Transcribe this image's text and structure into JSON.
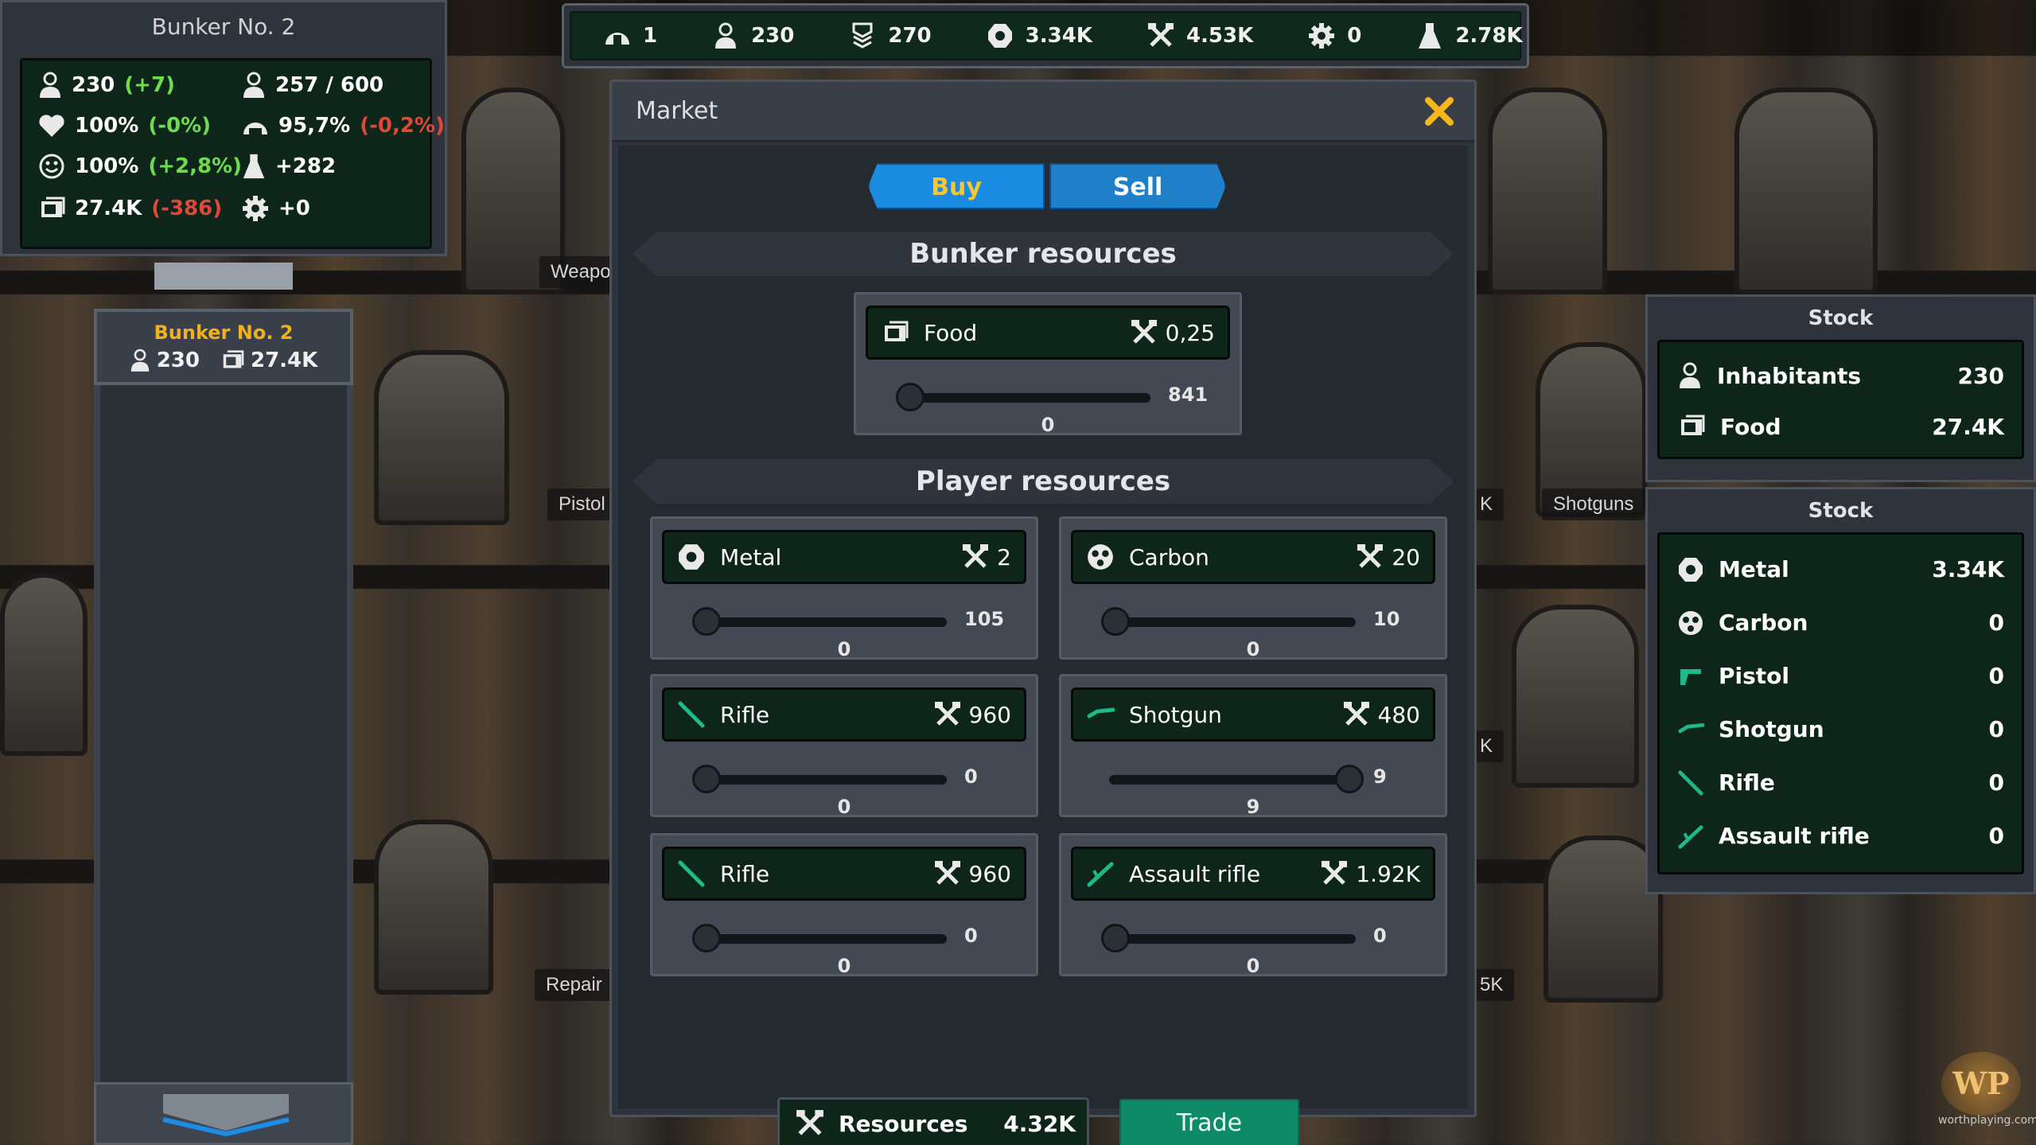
{
  "room_labels": [
    "Weapo",
    "Pistol",
    "Repair",
    "Shotguns",
    "K",
    "K",
    "5K"
  ],
  "topbar": {
    "items": [
      {
        "icon": "dome-icon",
        "value": "1"
      },
      {
        "icon": "person-icon",
        "value": "230"
      },
      {
        "icon": "rank-icon",
        "value": "270"
      },
      {
        "icon": "metal-icon",
        "value": "3.34K"
      },
      {
        "icon": "tools-icon",
        "value": "4.53K"
      },
      {
        "icon": "gear-icon",
        "value": "0"
      },
      {
        "icon": "flask-icon",
        "value": "2.78K"
      }
    ]
  },
  "bunker_panel": {
    "title": "Bunker No. 2",
    "stats": {
      "population": {
        "value": "230",
        "delta": "(+7)"
      },
      "capacity": {
        "value": "257 / 600"
      },
      "health": {
        "value": "100%",
        "delta": "(-0%)"
      },
      "morale": {
        "value": "95,7%",
        "delta": "(-0,2%)"
      },
      "happiness": {
        "value": "100%",
        "delta": "(+2,8%)"
      },
      "research": {
        "value": "+282"
      },
      "food": {
        "value": "27.4K",
        "delta": "(-386)"
      },
      "parts": {
        "value": "+0"
      }
    }
  },
  "left_bunker": {
    "name": "Bunker No. 2",
    "population": "230",
    "food": "27.4K"
  },
  "market": {
    "title": "Market",
    "tabs": {
      "buy": "Buy",
      "sell": "Sell"
    },
    "bunker_section": "Bunker resources",
    "player_section": "Player resources",
    "bunker_resources": [
      {
        "name": "Food",
        "icon": "food-icon",
        "price": "0,25",
        "max": "841",
        "value": "0",
        "fill": 0
      }
    ],
    "player_resources": [
      {
        "name": "Metal",
        "icon": "metal-icon",
        "price": "2",
        "max": "105",
        "value": "0",
        "fill": 0
      },
      {
        "name": "Carbon",
        "icon": "carbon-icon",
        "price": "20",
        "max": "10",
        "value": "0",
        "fill": 0
      },
      {
        "name": "Rifle",
        "icon": "rifle-icon",
        "price": "960",
        "max": "0",
        "value": "0",
        "fill": 0
      },
      {
        "name": "Shotgun",
        "icon": "shotgun-icon",
        "price": "480",
        "max": "9",
        "value": "9",
        "fill": 1
      },
      {
        "name": "Rifle",
        "icon": "rifle-icon",
        "price": "960",
        "max": "0",
        "value": "0",
        "fill": 0
      },
      {
        "name": "Assault rifle",
        "icon": "assault-rifle-icon",
        "price": "1.92K",
        "max": "0",
        "value": "0",
        "fill": 0
      }
    ],
    "footer": {
      "label": "Resources",
      "value": "4.32K",
      "trade": "Trade"
    }
  },
  "stock1": {
    "title": "Stock",
    "rows": [
      {
        "name": "Inhabitants",
        "icon": "person-icon",
        "value": "230"
      },
      {
        "name": "Food",
        "icon": "food-icon",
        "value": "27.4K"
      }
    ]
  },
  "stock2": {
    "title": "Stock",
    "rows": [
      {
        "name": "Metal",
        "icon": "metal-icon",
        "value": "3.34K"
      },
      {
        "name": "Carbon",
        "icon": "carbon-icon",
        "value": "0"
      },
      {
        "name": "Pistol",
        "icon": "pistol-icon",
        "value": "0"
      },
      {
        "name": "Shotgun",
        "icon": "shotgun-icon",
        "value": "0"
      },
      {
        "name": "Rifle",
        "icon": "rifle-icon",
        "value": "0"
      },
      {
        "name": "Assault rifle",
        "icon": "assault-rifle-icon",
        "value": "0"
      }
    ]
  },
  "watermark": {
    "logo": "WP",
    "text": "worthplaying.com"
  },
  "colors": {
    "accent_blue": "#1a8be0",
    "trade_green": "#0e8b66",
    "panel_green": "#0d2619",
    "gold": "#f2b01e",
    "close": "#f6b61e"
  }
}
